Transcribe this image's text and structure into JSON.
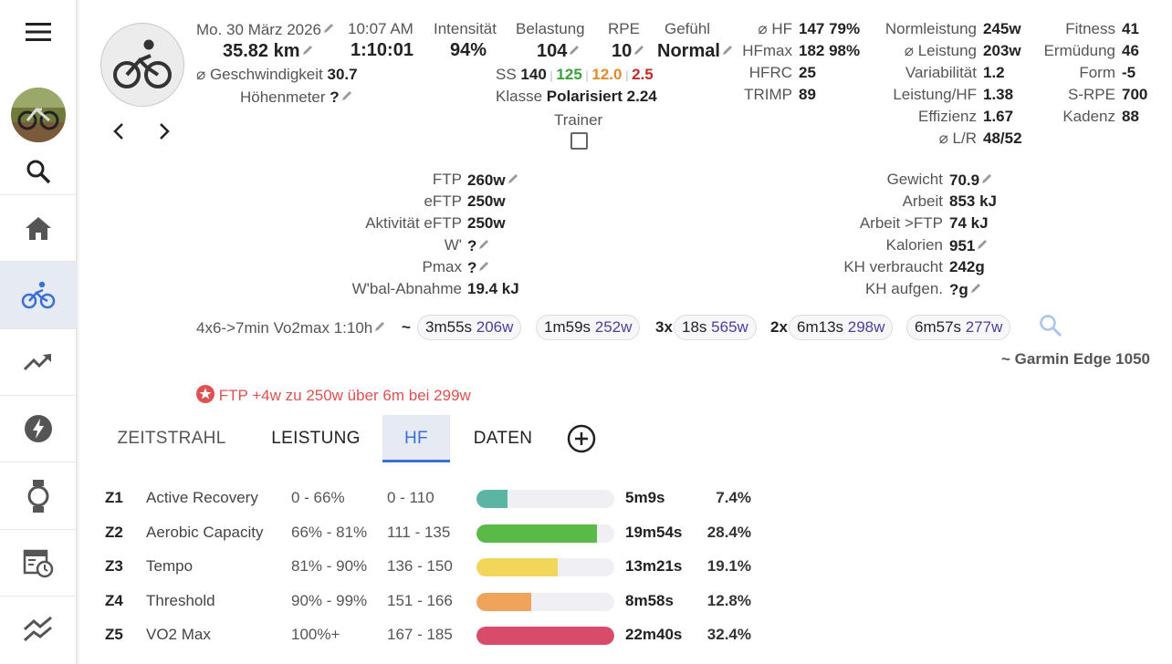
{
  "colors": {
    "accent": "#3a6fd8",
    "green": "#3aa13a",
    "orange": "#e38a2b",
    "red": "#c62828",
    "alert_red": "#e05050",
    "watts_purple": "#4b3f9a",
    "z1": "#5bb5a2",
    "z2": "#5aba47",
    "z3": "#f2d65a",
    "z4": "#f0a35a",
    "z5": "#d94b6a"
  },
  "sidebar": {
    "items": [
      "menu-icon",
      "avatar",
      "search-icon",
      "home-icon",
      "bike-icon",
      "trend-icon",
      "bolt-icon",
      "watch-icon",
      "calendar-clock-icon",
      "compare-icon"
    ]
  },
  "activity": {
    "date": "Mo. 30 März 2026",
    "time": "10:07 AM",
    "distance": "35.82 km",
    "duration": "1:10:01",
    "avg_speed_label": "⌀ Geschwindigkeit",
    "avg_speed": "30.7",
    "elevation_label": "Höhenmeter",
    "elevation": "?",
    "intensity_label": "Intensität",
    "intensity": "94%",
    "load_label": "Belastung",
    "load": "104",
    "rpe_label": "RPE",
    "rpe": "10",
    "feel_label": "Gefühl",
    "feel": "Normal",
    "ss_label": "SS",
    "ss_vals": [
      "140",
      "125",
      "12.0",
      "2.5"
    ],
    "class_label": "Klasse",
    "class_value": "Polarisiert 2.24",
    "trainer_label": "Trainer",
    "prev_icon": "chevron-left-icon",
    "next_icon": "chevron-right-icon"
  },
  "hr_stats": [
    {
      "label": "⌀ HF",
      "value": "147 79%"
    },
    {
      "label": "HFmax",
      "value": "182 98%"
    },
    {
      "label": "HFRC",
      "value": "25"
    },
    {
      "label": "TRIMP",
      "value": "89"
    }
  ],
  "power_stats": [
    {
      "label": "Normleistung",
      "value": "245w"
    },
    {
      "label": "⌀ Leistung",
      "value": "203w"
    },
    {
      "label": "Variabilität",
      "value": "1.2"
    },
    {
      "label": "Leistung/HF",
      "value": "1.38"
    },
    {
      "label": "Effizienz",
      "value": "1.67"
    },
    {
      "label": "⌀ L/R",
      "value": "48/52"
    }
  ],
  "fitness_stats": [
    {
      "label": "Fitness",
      "value": "41"
    },
    {
      "label": "Ermüdung",
      "value": "46"
    },
    {
      "label": "Form",
      "value": "-5"
    },
    {
      "label": "S-RPE",
      "value": "700"
    },
    {
      "label": "Kadenz",
      "value": "88"
    }
  ],
  "ftp_stats": [
    {
      "label": "FTP",
      "value": "260w",
      "edit": true
    },
    {
      "label": "eFTP",
      "value": "250w",
      "edit": false
    },
    {
      "label": "Aktivität eFTP",
      "value": "250w",
      "edit": false
    },
    {
      "label": "W'",
      "value": "?",
      "edit": true
    },
    {
      "label": "Pmax",
      "value": "?",
      "edit": true
    },
    {
      "label": "W'bal-Abnahme",
      "value": "19.4 kJ",
      "edit": false
    }
  ],
  "weight_stats": [
    {
      "label": "Gewicht",
      "value": "70.9",
      "edit": true
    },
    {
      "label": "Arbeit",
      "value": "853 kJ",
      "edit": false
    },
    {
      "label": "Arbeit >FTP",
      "value": "74 kJ",
      "edit": false
    },
    {
      "label": "Kalorien",
      "value": "951",
      "edit": true
    },
    {
      "label": "KH verbraucht",
      "value": "242g",
      "edit": false
    },
    {
      "label": "KH aufgen.",
      "value": "?g",
      "edit": true
    }
  ],
  "intervals": {
    "name": "4x6->7min Vo2max 1:10h",
    "tilde": "~",
    "chips": [
      {
        "prefix": "",
        "time": "3m55s",
        "watts": "206w"
      },
      {
        "prefix": "",
        "time": "1m59s",
        "watts": "252w"
      },
      {
        "prefix": "3x",
        "time": "18s",
        "watts": "565w"
      },
      {
        "prefix": "2x",
        "time": "6m13s",
        "watts": "298w"
      },
      {
        "prefix": "",
        "time": "6m57s",
        "watts": "277w"
      }
    ],
    "device": "~ Garmin Edge 1050"
  },
  "alert": {
    "text": "FTP +4w zu 250w über 6m bei 299w"
  },
  "tabs": [
    {
      "label": "ZEITSTRAHL",
      "active": false
    },
    {
      "label": "LEISTUNG",
      "active": false
    },
    {
      "label": "HF",
      "active": true
    },
    {
      "label": "DATEN",
      "active": false
    }
  ],
  "zones": [
    {
      "zone": "Z1",
      "name": "Active Recovery",
      "pct": "0 - 66%",
      "bpm": "0 - 110",
      "time": "5m9s",
      "share": "7.4%",
      "fill": 0.228
    },
    {
      "zone": "Z2",
      "name": "Aerobic Capacity",
      "pct": "66% - 81%",
      "bpm": "111 - 135",
      "time": "19m54s",
      "share": "28.4%",
      "fill": 0.877
    },
    {
      "zone": "Z3",
      "name": "Tempo",
      "pct": "81% - 90%",
      "bpm": "136 - 150",
      "time": "13m21s",
      "share": "19.1%",
      "fill": 0.59
    },
    {
      "zone": "Z4",
      "name": "Threshold",
      "pct": "90% - 99%",
      "bpm": "151 - 166",
      "time": "8m58s",
      "share": "12.8%",
      "fill": 0.395
    },
    {
      "zone": "Z5",
      "name": "VO2 Max",
      "pct": "100%+",
      "bpm": "167 - 185",
      "time": "22m40s",
      "share": "32.4%",
      "fill": 1.0
    }
  ]
}
